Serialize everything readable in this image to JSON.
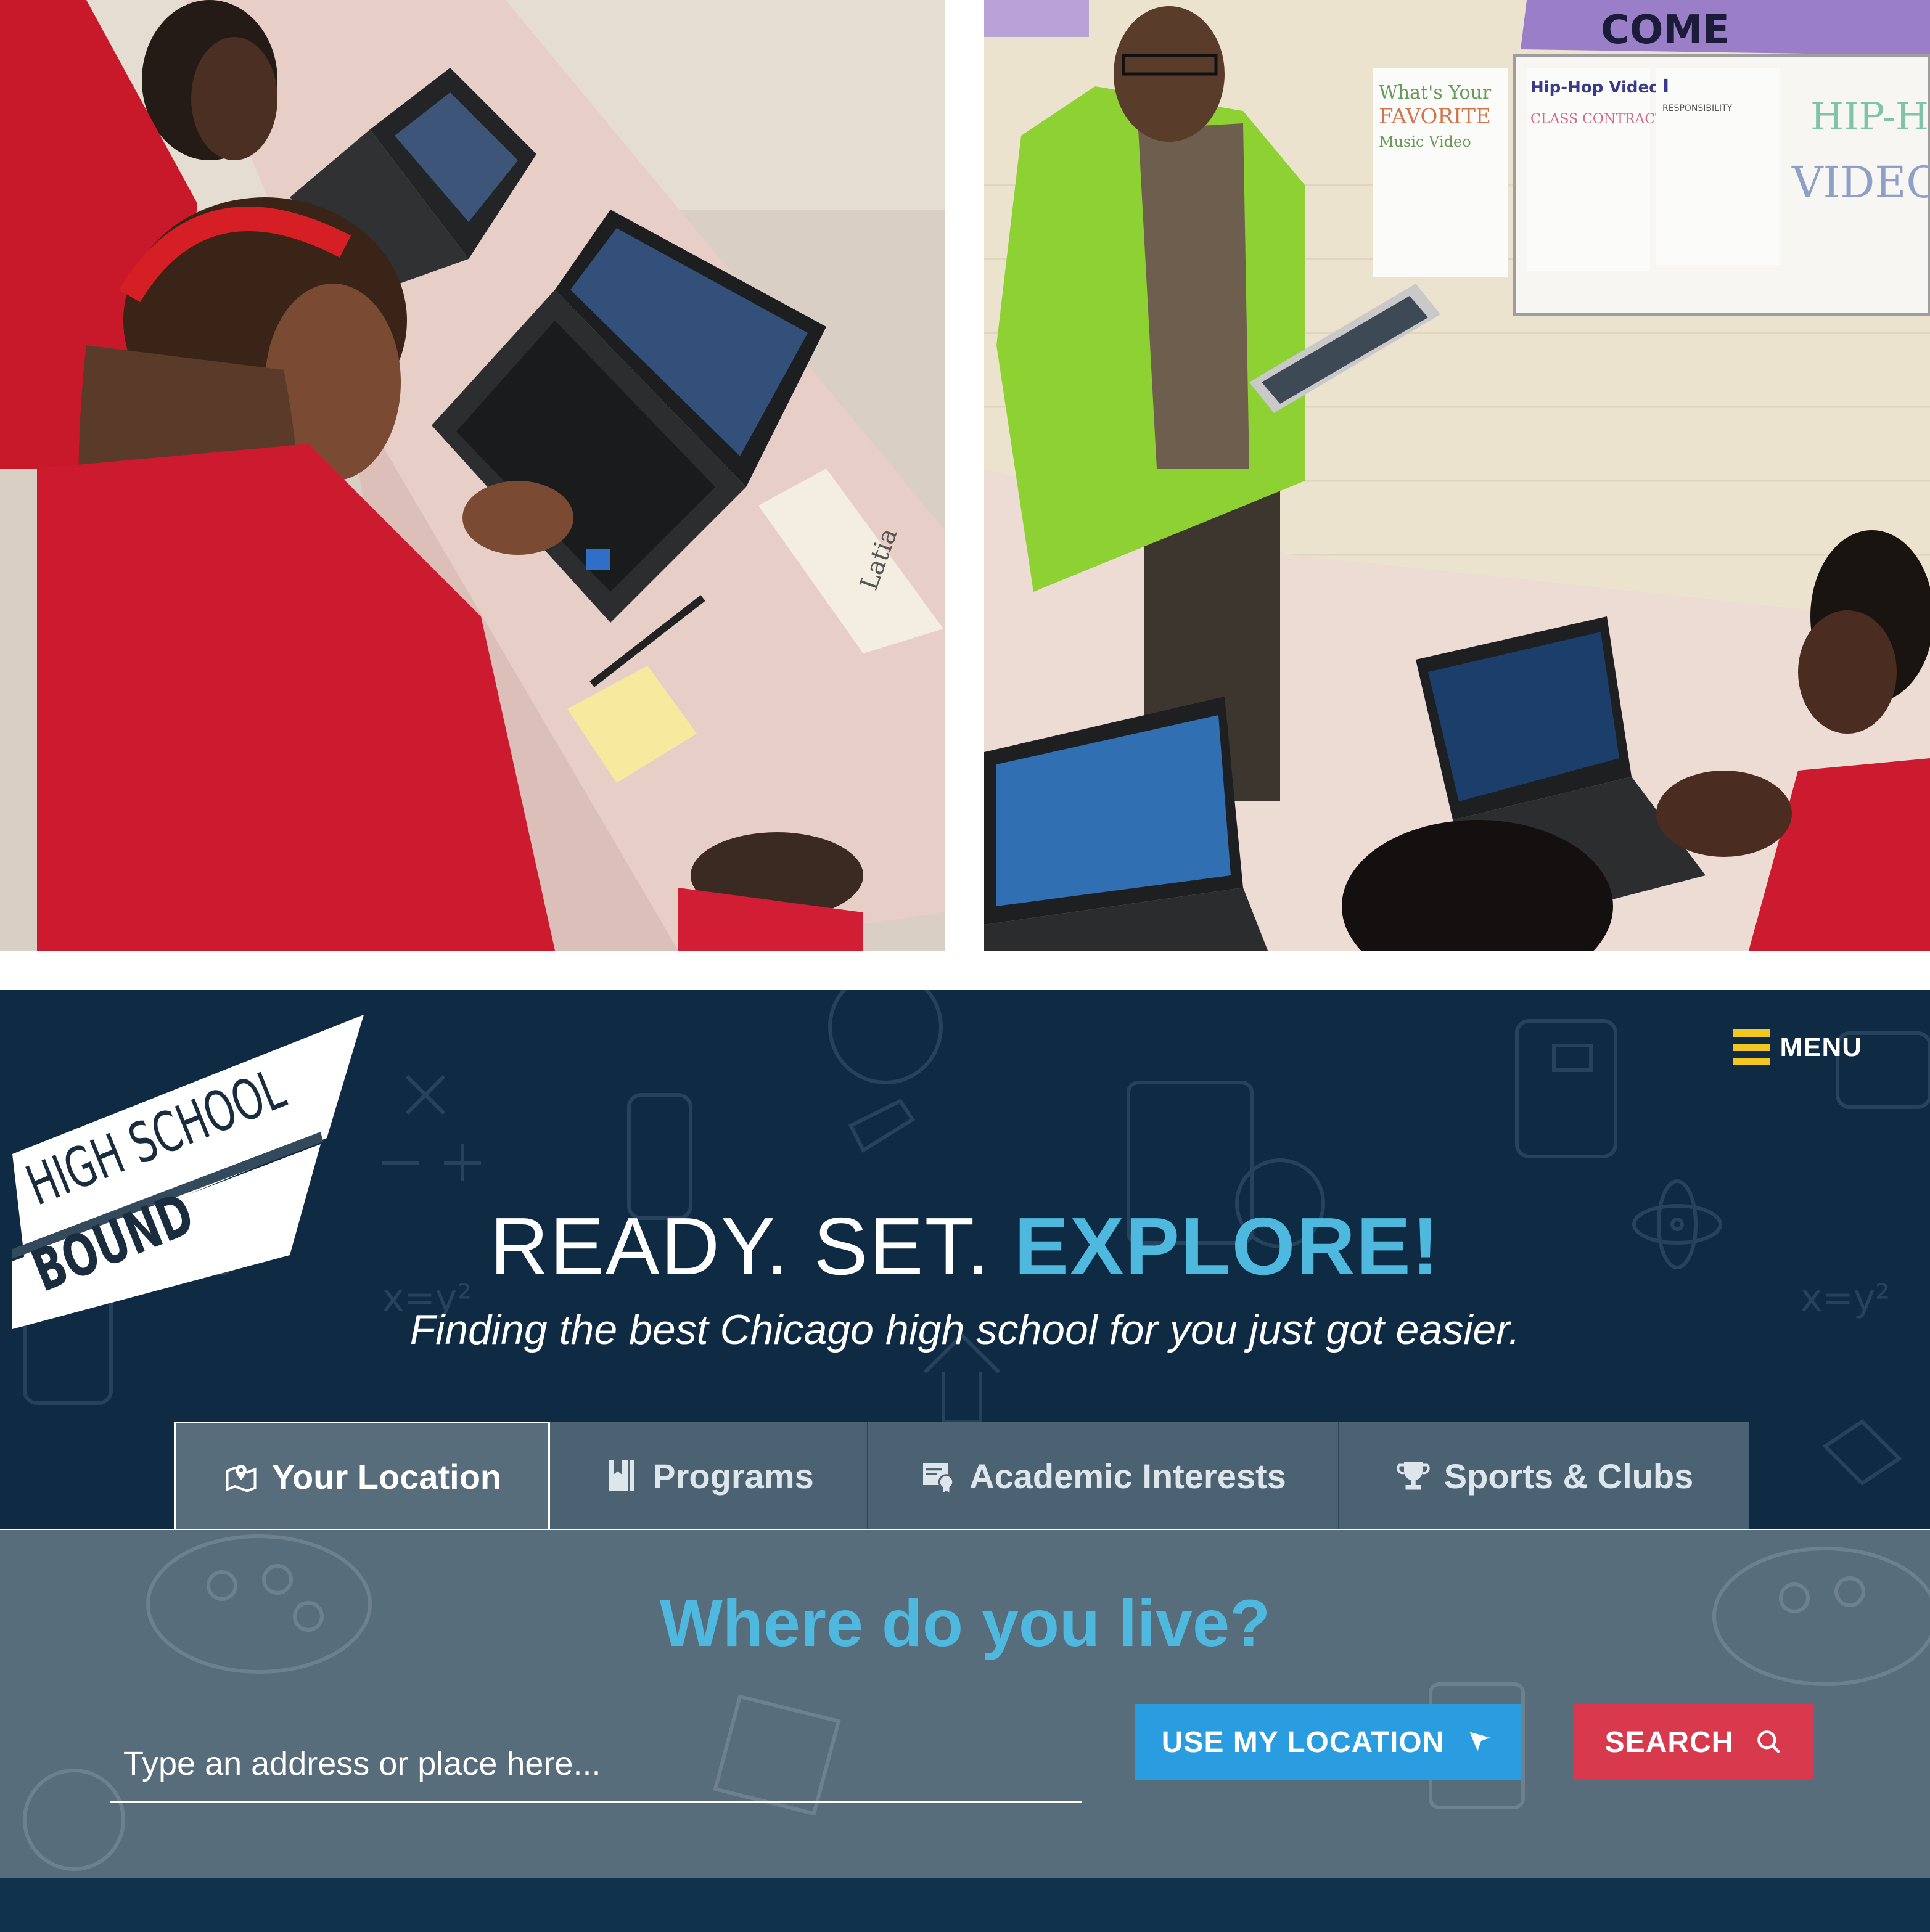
{
  "photos": {
    "left": {},
    "right": {
      "whiteboard_text": [
        "COME",
        "What's Your",
        "FAVORITE",
        "Music Video",
        "Hip-Hop Video",
        "CLASS CONTRACT",
        "I",
        "RESPONSIBILITY",
        "HIP-HOP",
        "VIDEOS"
      ],
      "name_card": "Latia"
    }
  },
  "site": {
    "menu_label": "MENU",
    "logo": {
      "line1": "HIGH SCHOOL",
      "line2": "BOUND"
    },
    "headline": {
      "part1": "READY. SET. ",
      "part2": "EXPLORE!"
    },
    "tagline": "Finding the best Chicago high school for you just got easier.",
    "tabs": [
      {
        "label": "Your Location",
        "icon": "map-pin-icon",
        "active": true
      },
      {
        "label": "Programs",
        "icon": "bookmark-icon",
        "active": false
      },
      {
        "label": "Academic Interests",
        "icon": "certificate-icon",
        "active": false
      },
      {
        "label": "Sports & Clubs",
        "icon": "trophy-icon",
        "active": false
      }
    ],
    "search": {
      "question": "Where do you live?",
      "placeholder": "Type an address or place here...",
      "use_location_label": "USE MY LOCATION",
      "search_label": "SEARCH"
    },
    "colors": {
      "background": "#0f2b44",
      "accent": "#4fb8de",
      "panel": "#586d7c",
      "tab": "#4b6273",
      "menu_icon": "#f4c623",
      "location_button": "#2a9de0",
      "search_button": "#d8394d"
    }
  }
}
